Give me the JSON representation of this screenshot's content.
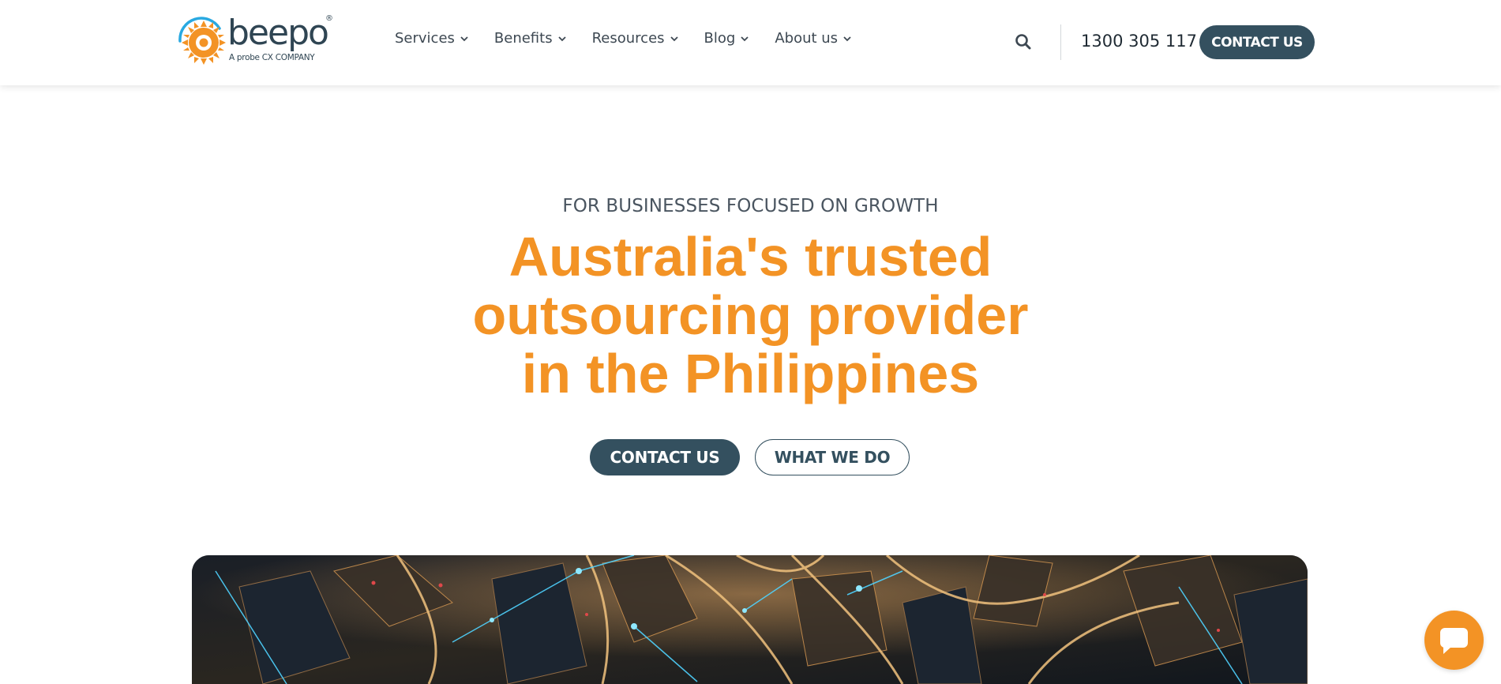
{
  "brand": {
    "name": "beepo",
    "registered_mark": "®",
    "tagline": "A probe CX COMPANY"
  },
  "nav": {
    "items": [
      {
        "label": "Services"
      },
      {
        "label": "Benefits"
      },
      {
        "label": "Resources"
      },
      {
        "label": "Blog"
      },
      {
        "label": "About us"
      }
    ]
  },
  "header": {
    "search_icon": "search-icon",
    "phone": "1300 305 117",
    "cta_label": "CONTACT US"
  },
  "hero": {
    "eyebrow": "FOR BUSINESSES FOCUSED ON GROWTH",
    "headline_lines": [
      "Australia's trusted",
      "outsourcing provider",
      "in the Philippines"
    ],
    "primary_button": "CONTACT US",
    "secondary_button": "WHAT WE DO"
  },
  "chat": {
    "icon": "chat-bubble-icon"
  },
  "colors": {
    "accent_orange": "#f39325",
    "primary_dark": "#34505f",
    "text": "#3d4852"
  }
}
